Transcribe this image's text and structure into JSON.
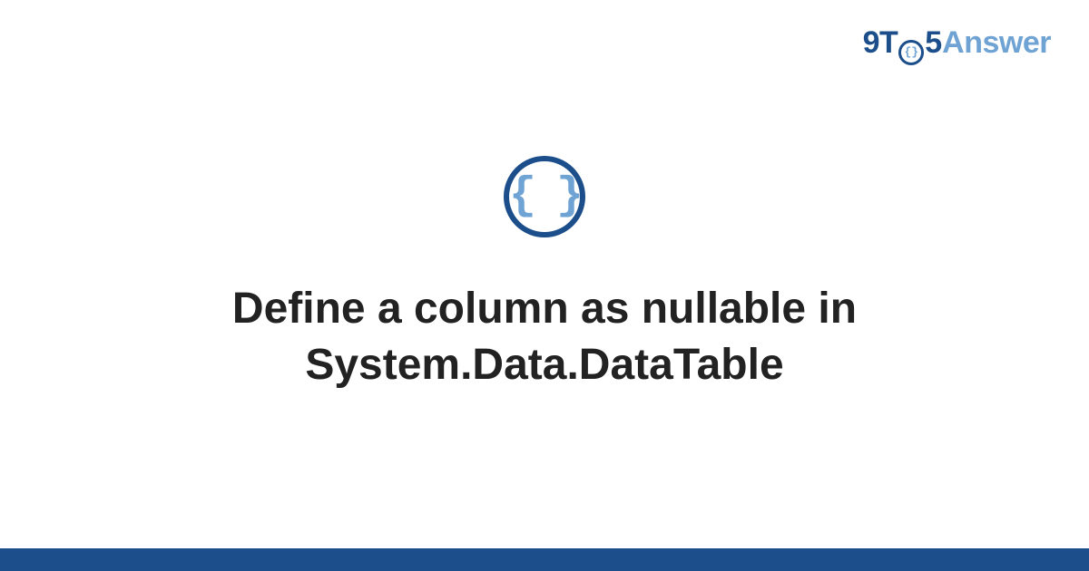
{
  "brand": {
    "part1": "9T",
    "part_o_inner": "{}",
    "part5": "5",
    "part_answer": "Answer"
  },
  "icon": {
    "glyph": "{ }"
  },
  "title": "Define a column as nullable in System.Data.DataTable",
  "colors": {
    "primary": "#1b4e8a",
    "accent": "#6fa3d4"
  }
}
